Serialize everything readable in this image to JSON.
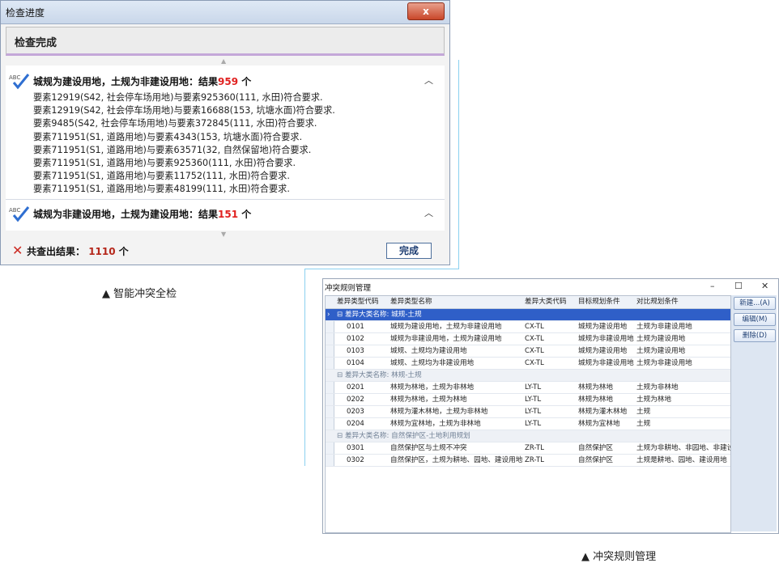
{
  "check_window": {
    "title": "检查进度",
    "close_label": "x",
    "status": "检查完成",
    "groups": [
      {
        "title": "城规为建设用地，土规为非建设用地：结果",
        "count": "959",
        "unit": "个",
        "lines": [
          "要素12919(S42, 社会停车场用地)与要素925360(111, 水田)符合要求.",
          "要素12919(S42, 社会停车场用地)与要素16688(153, 坑塘水面)符合要求.",
          "要素9485(S42, 社会停车场用地)与要素372845(111, 水田)符合要求.",
          "要素711951(S1, 道路用地)与要素4343(153, 坑塘水面)符合要求.",
          "要素711951(S1, 道路用地)与要素63571(32, 自然保留地)符合要求.",
          "要素711951(S1, 道路用地)与要素925360(111, 水田)符合要求.",
          "要素711951(S1, 道路用地)与要素11752(111, 水田)符合要求.",
          "要素711951(S1, 道路用地)与要素48199(111, 水田)符合要求."
        ]
      },
      {
        "title": "城规为非建设用地，土规为建设用地：结果",
        "count": "151",
        "unit": "个",
        "lines": []
      }
    ],
    "footer": {
      "label": "共查出结果：",
      "total": "1110",
      "unit": "个",
      "done_button": "完成"
    },
    "caption": "▲  智能冲突全检"
  },
  "rules_window": {
    "title": "冲突规则管理",
    "controls": [
      "–",
      "☐",
      "✕"
    ],
    "columns": [
      "差异类型代码",
      "差异类型名称",
      "差异大类代码",
      "目标规划条件",
      "对比规划条件"
    ],
    "groups": [
      {
        "label": "差异大类名称: 城规-土规",
        "rows": [
          [
            "0101",
            "城规为建设用地，土规为非建设用地",
            "CX-TL",
            "城规为建设用地",
            "土规为非建设用地"
          ],
          [
            "0102",
            "城规为非建设用地，土规为建设用地",
            "CX-TL",
            "城规为非建设用地",
            "土规为建设用地"
          ],
          [
            "0103",
            "城规、土规均为建设用地",
            "CX-TL",
            "城规为建设用地",
            "土规为建设用地"
          ],
          [
            "0104",
            "城规、土规均为非建设用地",
            "CX-TL",
            "城规为非建设用地",
            "土规为非建设用地"
          ]
        ]
      },
      {
        "label": "差异大类名称: 林规-土规",
        "rows": [
          [
            "0201",
            "林规为林地，土规为非林地",
            "LY-TL",
            "林规为林地",
            "土规为非林地"
          ],
          [
            "0202",
            "林规为林地，土规为林地",
            "LY-TL",
            "林规为林地",
            "土规为林地"
          ],
          [
            "0203",
            "林规为灌木林地，土规为非林地",
            "LY-TL",
            "林规为灌木林地",
            "土规"
          ],
          [
            "0204",
            "林规为宜林地，土规为非林地",
            "LY-TL",
            "林规为宜林地",
            "土规"
          ]
        ]
      },
      {
        "label": "差异大类名称: 自然保护区-土地利用规划",
        "rows": [
          [
            "0301",
            "自然保护区与土规不冲突",
            "ZR-TL",
            "自然保护区",
            "土规为非耕地、非园地、非建设"
          ],
          [
            "0302",
            "自然保护区，土规为耕地、园地、建设用地",
            "ZR-TL",
            "自然保护区",
            "土规是耕地、园地、建设用地"
          ]
        ]
      }
    ],
    "buttons": [
      "新建...(A)",
      "编辑(M)",
      "删除(D)"
    ],
    "caption": "▲  冲突规则管理"
  },
  "colors": {
    "result_count": "#e0201f",
    "selected_group": "#2f5fc8",
    "close_button": "#c9472a"
  }
}
